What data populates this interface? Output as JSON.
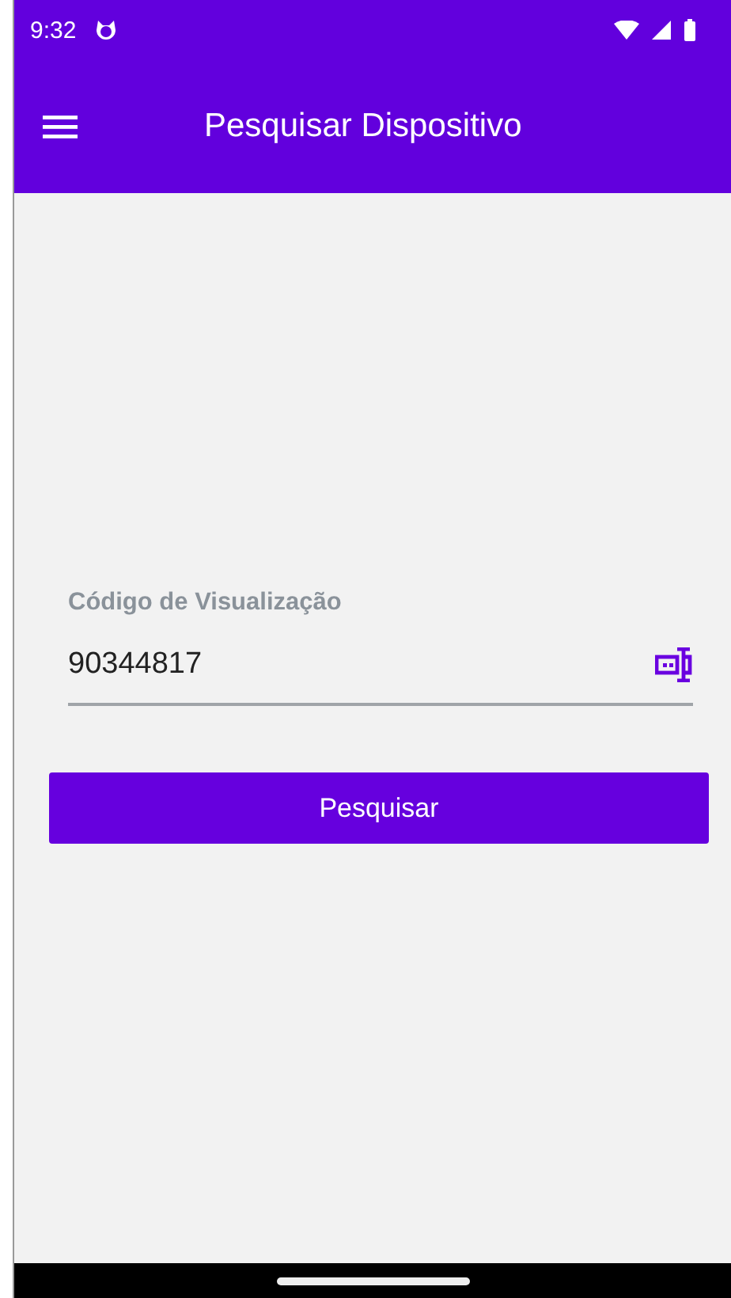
{
  "status_bar": {
    "time": "9:32"
  },
  "app_bar": {
    "title": "Pesquisar Dispositivo"
  },
  "field": {
    "label": "Código de Visualização",
    "value": "90344817"
  },
  "buttons": [
    "Pesquisar"
  ]
}
